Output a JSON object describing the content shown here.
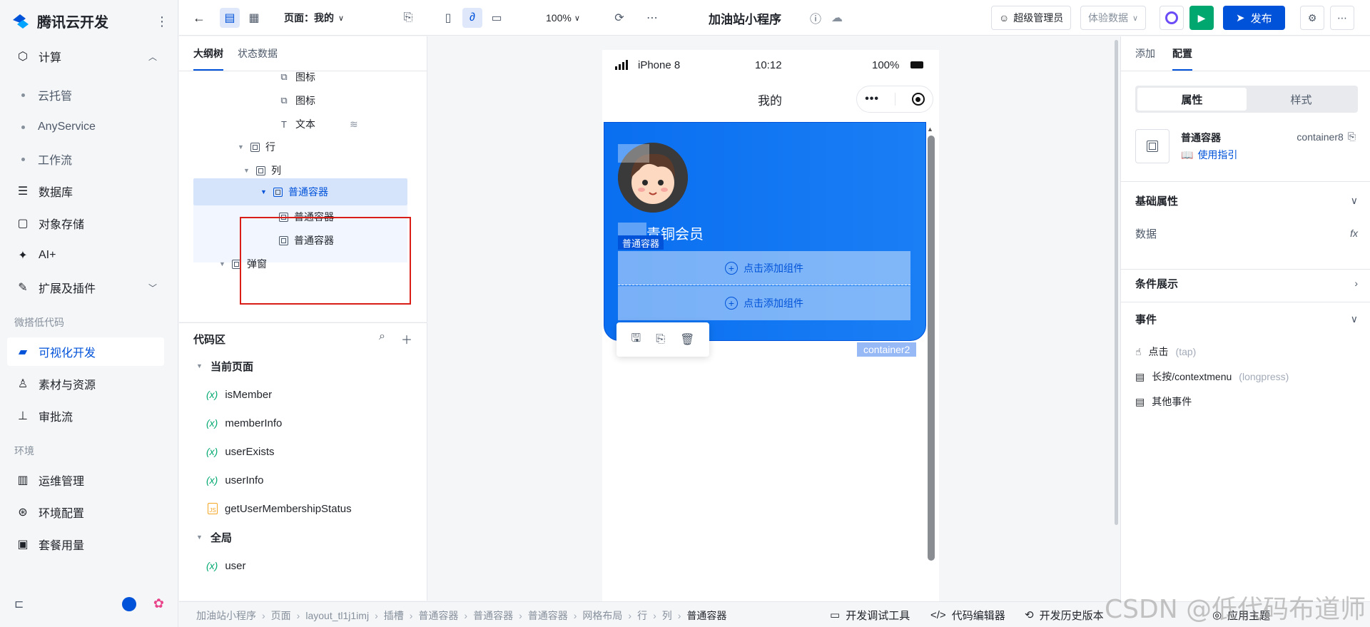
{
  "brand": {
    "name": "腾讯云开发"
  },
  "leftnav": {
    "items": [
      {
        "label": "计算",
        "icon": "shield-icon"
      },
      {
        "label": "数据库",
        "icon": "database-icon"
      },
      {
        "label": "对象存储",
        "icon": "storage-icon"
      },
      {
        "label": "AI+",
        "icon": "sparkle-icon"
      },
      {
        "label": "扩展及插件",
        "icon": "puzzle-icon"
      },
      {
        "label": "可视化开发",
        "icon": "visual-dev-icon"
      },
      {
        "label": "素材与资源",
        "icon": "assets-icon"
      },
      {
        "label": "审批流",
        "icon": "approval-icon"
      },
      {
        "label": "运维管理",
        "icon": "ops-icon"
      },
      {
        "label": "环境配置",
        "icon": "env-icon"
      },
      {
        "label": "套餐用量",
        "icon": "package-icon"
      }
    ],
    "sub": [
      "云托管",
      "AnyService",
      "工作流"
    ],
    "sections": [
      "微搭低代码",
      "环境"
    ]
  },
  "toolbar": {
    "page_label": "页面：我的",
    "zoom": "100%",
    "app_title": "加油站小程序",
    "admin_label": "超级管理员",
    "data_label": "体验数据",
    "publish_label": "发布"
  },
  "outline": {
    "tabs": [
      "大纲树",
      "状态数据"
    ],
    "nodes": [
      "图标",
      "图标",
      "文本",
      "行",
      "列",
      "普通容器",
      "普通容器",
      "普通容器",
      "弹窗"
    ]
  },
  "code": {
    "title": "代码区",
    "groups": [
      "当前页面",
      "全局"
    ],
    "items": [
      "isMember",
      "memberInfo",
      "userExists",
      "userInfo",
      "getUserMembershipStatus",
      "user"
    ],
    "var_glyph": "(x)"
  },
  "phone": {
    "device": "iPhone 8",
    "time": "10:12",
    "battery": "100%",
    "page_title": "我的",
    "member_text": "青铜会员",
    "selected_tag": "普通容器",
    "slot_label": "点击添加组件",
    "container_tag": "container2"
  },
  "rightpanel": {
    "tabs": [
      "添加",
      "配置"
    ],
    "segments": [
      "属性",
      "样式"
    ],
    "component_name": "普通容器",
    "component_id": "container8",
    "guide_label": "使用指引",
    "basic_props": "基础属性",
    "data_label": "数据",
    "fx_label": "fx",
    "condition_label": "条件展示",
    "events_label": "事件",
    "events": [
      {
        "name": "点击",
        "hint": "(tap)"
      },
      {
        "name": "长按/contextmenu",
        "hint": "(longpress)"
      },
      {
        "name": "其他事件",
        "hint": ""
      }
    ]
  },
  "bottombar": {
    "crumbs": [
      "加油站小程序",
      "页面",
      "layout_tl1j1imj",
      "插槽",
      "普通容器",
      "普通容器",
      "普通容器",
      "网格布局",
      "行",
      "列",
      "普通容器"
    ],
    "tools": [
      "开发调试工具",
      "代码编辑器",
      "开发历史版本",
      "应用主题"
    ]
  },
  "watermark": "CSDN @低代码布道师",
  "colors": {
    "accent": "#0052d9",
    "run": "#00a870",
    "highlight": "#d91e18"
  }
}
